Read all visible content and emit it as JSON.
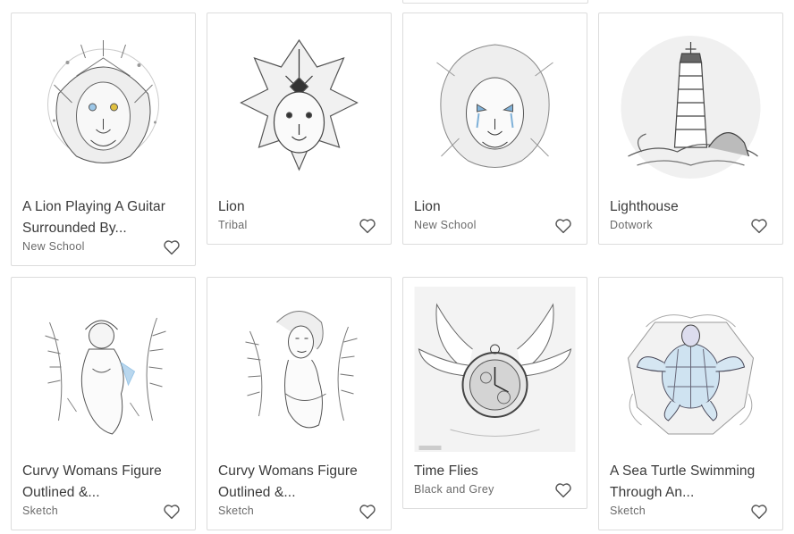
{
  "gallery": {
    "cards": [
      {
        "title_line1": "A Lion Playing A Guitar",
        "title_line2": "Surrounded By...",
        "style": "New School",
        "image": "lion-guitar-tattoo-image"
      },
      {
        "title_line1": "Lion",
        "title_line2": "",
        "style": "Tribal",
        "image": "lion-tribal-tattoo-image"
      },
      {
        "title_line1": "Lion",
        "title_line2": "",
        "style": "New School",
        "image": "lion-new-school-tattoo-image"
      },
      {
        "title_line1": "Lighthouse",
        "title_line2": "",
        "style": "Dotwork",
        "image": "lighthouse-tattoo-image"
      },
      {
        "title_line1": "Curvy Womans Figure",
        "title_line2": "Outlined &...",
        "style": "Sketch",
        "image": "woman-ferns-tattoo-image"
      },
      {
        "title_line1": "Curvy Womans Figure",
        "title_line2": "Outlined &...",
        "style": "Sketch",
        "image": "woman-ferns-tattoo-image-2"
      },
      {
        "title_line1": "Time Flies",
        "title_line2": "",
        "style": "Black and Grey",
        "image": "winged-pocket-watch-tattoo-image"
      },
      {
        "title_line1": "A Sea Turtle Swimming",
        "title_line2": "Through An...",
        "style": "Sketch",
        "image": "sea-turtle-tattoo-image"
      }
    ],
    "favorite_icon": "heart-outline-icon"
  },
  "colors": {
    "border": "#dcdcdc",
    "title_text": "#3a3a3a",
    "subtitle_text": "#6a6a6a",
    "icon": "#555555",
    "accent_blue": "#9cc7e8"
  }
}
